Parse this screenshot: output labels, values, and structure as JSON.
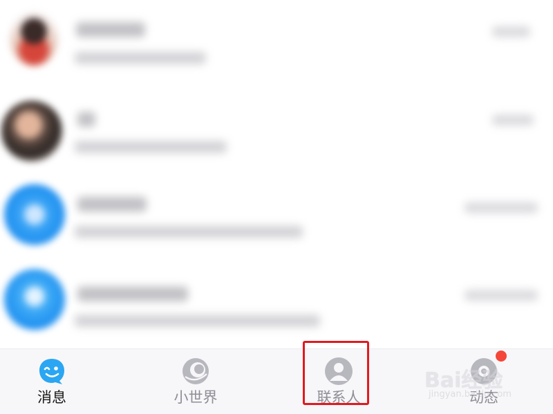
{
  "tab_bar": {
    "tabs": [
      {
        "id": "messages",
        "label": "消息",
        "icon": "qq-penguin-wink-icon",
        "active": true
      },
      {
        "id": "world",
        "label": "小世界",
        "icon": "small-world-planet-icon",
        "active": false
      },
      {
        "id": "contacts",
        "label": "联系人",
        "icon": "contact-person-icon",
        "active": false
      },
      {
        "id": "moments",
        "label": "动态",
        "icon": "moments-icon",
        "active": false,
        "has_badge": true
      }
    ]
  },
  "watermark": {
    "brand": "Bai经验",
    "domain": "jingyan.baidu.com"
  },
  "colors": {
    "active_blue": "#2aa6f3",
    "inactive_gray": "#b7b7be",
    "highlight_red": "#e3181e",
    "badge_red": "#f5463a",
    "tab_bar_bg": "#f7f7f9"
  }
}
